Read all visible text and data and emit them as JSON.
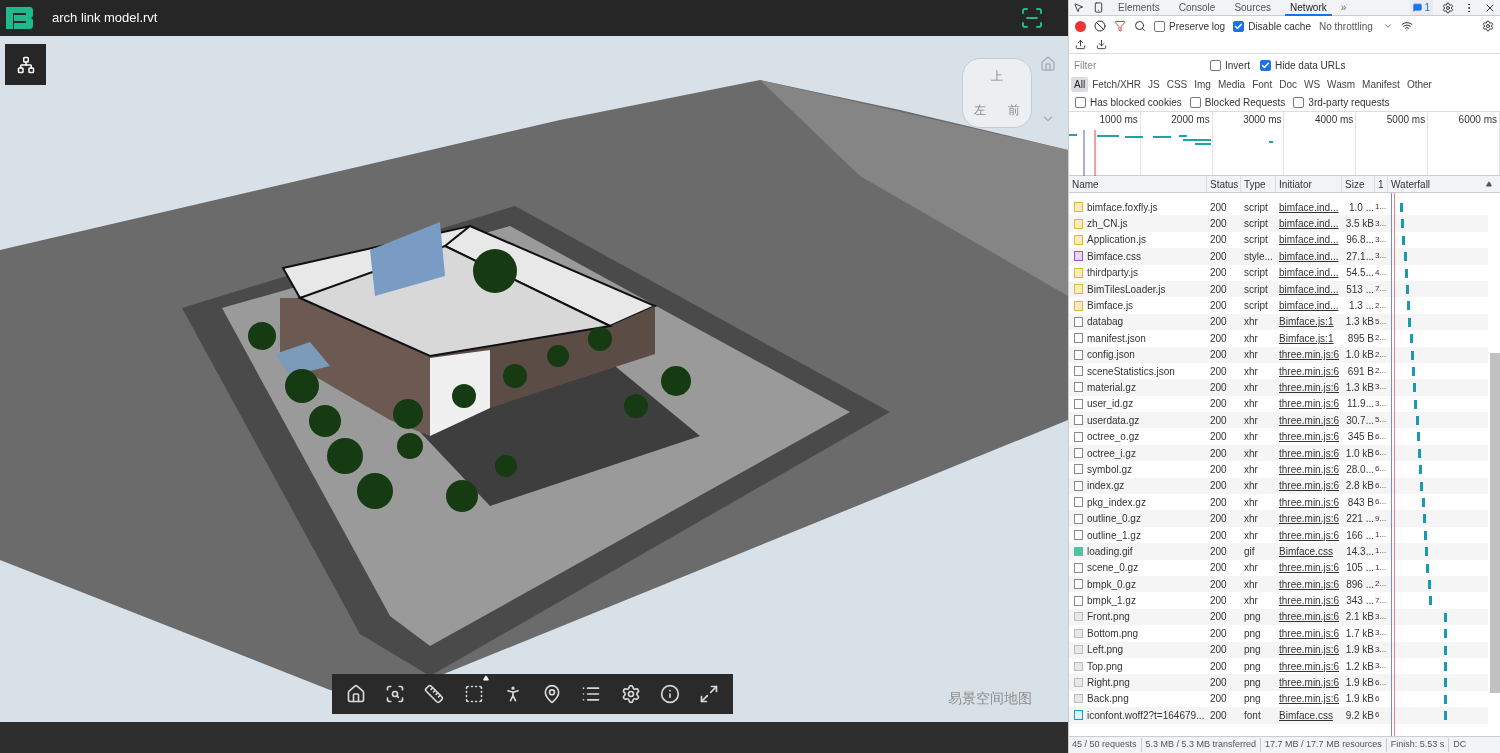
{
  "viewer": {
    "title": "arch link model.rvt",
    "view_cube": [
      "上",
      "左",
      "前"
    ],
    "attribution": "易景空间地图"
  },
  "devtools": {
    "tabs": [
      {
        "label": "Elements",
        "selected": false
      },
      {
        "label": "Console",
        "selected": false
      },
      {
        "label": "Sources",
        "selected": false
      },
      {
        "label": "Network",
        "selected": true
      }
    ],
    "more_tabs": "»",
    "message_count": "1",
    "toolbar": {
      "recording": true,
      "preserve_log": {
        "label": "Preserve log",
        "checked": false
      },
      "disable_cache": {
        "label": "Disable cache",
        "checked": true
      },
      "throttling": "No throttling"
    },
    "filter": {
      "placeholder": "Filter",
      "invert": {
        "label": "Invert",
        "checked": false
      },
      "hide_data_urls": {
        "label": "Hide data URLs",
        "checked": true
      }
    },
    "type_filters": [
      {
        "label": "All",
        "selected": true
      },
      {
        "label": "Fetch/XHR",
        "selected": false
      },
      {
        "label": "JS",
        "selected": false
      },
      {
        "label": "CSS",
        "selected": false
      },
      {
        "label": "Img",
        "selected": false
      },
      {
        "label": "Media",
        "selected": false
      },
      {
        "label": "Font",
        "selected": false
      },
      {
        "label": "Doc",
        "selected": false
      },
      {
        "label": "WS",
        "selected": false
      },
      {
        "label": "Wasm",
        "selected": false
      },
      {
        "label": "Manifest",
        "selected": false
      },
      {
        "label": "Other",
        "selected": false
      }
    ],
    "blocked_filters": [
      {
        "label": "Has blocked cookies",
        "checked": false
      },
      {
        "label": "Blocked Requests",
        "checked": false
      },
      {
        "label": "3rd-party requests",
        "checked": false
      }
    ],
    "overview_ticks": [
      "1000 ms",
      "2000 ms",
      "3000 ms",
      "4000 ms",
      "5000 ms",
      "6000 ms"
    ],
    "table": {
      "columns": [
        "Name",
        "Status",
        "Type",
        "Initiator",
        "Size",
        "1",
        "Waterfall"
      ],
      "rows": [
        {
          "kind": "script",
          "name": "bimface.foxfly.js",
          "status": "200",
          "type": "script",
          "initiator": "bimface.ind...",
          "size": "1.0 ...",
          "column_6": "1..."
        },
        {
          "kind": "script",
          "name": "zh_CN.js",
          "status": "200",
          "type": "script",
          "initiator": "bimface.ind...",
          "size": "3.5 kB",
          "column_6": "3..."
        },
        {
          "kind": "script",
          "name": "Application.js",
          "status": "200",
          "type": "script",
          "initiator": "bimface.ind...",
          "size": "96.8...",
          "column_6": "3..."
        },
        {
          "kind": "stylesheet",
          "name": "Bimface.css",
          "status": "200",
          "type": "style...",
          "initiator": "bimface.ind...",
          "size": "27.1...",
          "column_6": "3..."
        },
        {
          "kind": "script",
          "name": "thirdparty.js",
          "status": "200",
          "type": "script",
          "initiator": "bimface.ind...",
          "size": "54.5...",
          "column_6": "4..."
        },
        {
          "kind": "script",
          "name": "BimTilesLoader.js",
          "status": "200",
          "type": "script",
          "initiator": "bimface.ind...",
          "size": "513 ...",
          "column_6": "7..."
        },
        {
          "kind": "script",
          "name": "Bimface.js",
          "status": "200",
          "type": "script",
          "initiator": "bimface.ind...",
          "size": "1.3 ...",
          "column_6": "2..."
        },
        {
          "kind": "xhr",
          "name": "databag",
          "status": "200",
          "type": "xhr",
          "initiator": "Bimface.js:1",
          "size": "1.3 kB",
          "column_6": "5..."
        },
        {
          "kind": "xhr",
          "name": "manifest.json",
          "status": "200",
          "type": "xhr",
          "initiator": "Bimface.js:1",
          "size": "895 B",
          "column_6": "2..."
        },
        {
          "kind": "xhr",
          "name": "config.json",
          "status": "200",
          "type": "xhr",
          "initiator": "three.min.js:6",
          "size": "1.0 kB",
          "column_6": "2..."
        },
        {
          "kind": "xhr",
          "name": "sceneStatistics.json",
          "status": "200",
          "type": "xhr",
          "initiator": "three.min.js:6",
          "size": "691 B",
          "column_6": "2..."
        },
        {
          "kind": "xhr",
          "name": "material.gz",
          "status": "200",
          "type": "xhr",
          "initiator": "three.min.js:6",
          "size": "1.3 kB",
          "column_6": "3..."
        },
        {
          "kind": "xhr",
          "name": "user_id.gz",
          "status": "200",
          "type": "xhr",
          "initiator": "three.min.js:6",
          "size": "11.9...",
          "column_6": "3..."
        },
        {
          "kind": "xhr",
          "name": "userdata.gz",
          "status": "200",
          "type": "xhr",
          "initiator": "three.min.js:6",
          "size": "30.7...",
          "column_6": "5..."
        },
        {
          "kind": "xhr",
          "name": "octree_o.gz",
          "status": "200",
          "type": "xhr",
          "initiator": "three.min.js:6",
          "size": "345 B",
          "column_6": "6..."
        },
        {
          "kind": "xhr",
          "name": "octree_i.gz",
          "status": "200",
          "type": "xhr",
          "initiator": "three.min.js:6",
          "size": "1.0 kB",
          "column_6": "6..."
        },
        {
          "kind": "xhr",
          "name": "symbol.gz",
          "status": "200",
          "type": "xhr",
          "initiator": "three.min.js:6",
          "size": "28.0...",
          "column_6": "6..."
        },
        {
          "kind": "xhr",
          "name": "index.gz",
          "status": "200",
          "type": "xhr",
          "initiator": "three.min.js:6",
          "size": "2.8 kB",
          "column_6": "6..."
        },
        {
          "kind": "xhr",
          "name": "pkg_index.gz",
          "status": "200",
          "type": "xhr",
          "initiator": "three.min.js:6",
          "size": "843 B",
          "column_6": "6..."
        },
        {
          "kind": "xhr",
          "name": "outline_0.gz",
          "status": "200",
          "type": "xhr",
          "initiator": "three.min.js:6",
          "size": "221 ...",
          "column_6": "9..."
        },
        {
          "kind": "xhr",
          "name": "outline_1.gz",
          "status": "200",
          "type": "xhr",
          "initiator": "three.min.js:6",
          "size": "166 ...",
          "column_6": "1..."
        },
        {
          "kind": "gif",
          "name": "loading.gif",
          "status": "200",
          "type": "gif",
          "initiator": "Bimface.css",
          "size": "14.3...",
          "column_6": "1..."
        },
        {
          "kind": "xhr",
          "name": "scene_0.gz",
          "status": "200",
          "type": "xhr",
          "initiator": "three.min.js:6",
          "size": "105 ...",
          "column_6": "1..."
        },
        {
          "kind": "xhr",
          "name": "bmpk_0.gz",
          "status": "200",
          "type": "xhr",
          "initiator": "three.min.js:6",
          "size": "896 ...",
          "column_6": "2..."
        },
        {
          "kind": "xhr",
          "name": "bmpk_1.gz",
          "status": "200",
          "type": "xhr",
          "initiator": "three.min.js:6",
          "size": "343 ...",
          "column_6": "7..."
        },
        {
          "kind": "image",
          "name": "Front.png",
          "status": "200",
          "type": "png",
          "initiator": "three.min.js:6",
          "size": "2.1 kB",
          "column_6": "3..."
        },
        {
          "kind": "image",
          "name": "Bottom.png",
          "status": "200",
          "type": "png",
          "initiator": "three.min.js:6",
          "size": "1.7 kB",
          "column_6": "3..."
        },
        {
          "kind": "image",
          "name": "Left.png",
          "status": "200",
          "type": "png",
          "initiator": "three.min.js:6",
          "size": "1.9 kB",
          "column_6": "3..."
        },
        {
          "kind": "image",
          "name": "Top.png",
          "status": "200",
          "type": "png",
          "initiator": "three.min.js:6",
          "size": "1.2 kB",
          "column_6": "3..."
        },
        {
          "kind": "image",
          "name": "Right.png",
          "status": "200",
          "type": "png",
          "initiator": "three.min.js:6",
          "size": "1.9 kB",
          "column_6": "6..."
        },
        {
          "kind": "image",
          "name": "Back.png",
          "status": "200",
          "type": "png",
          "initiator": "three.min.js:6",
          "size": "1.9 kB",
          "column_6": "6"
        },
        {
          "kind": "font",
          "name": "iconfont.woff2?t=164679...",
          "status": "200",
          "type": "font",
          "initiator": "Bimface.css",
          "size": "9.2 kB",
          "column_6": "6"
        }
      ]
    },
    "status_bar": [
      "45 / 50 requests",
      "5.3 MB / 5.3 MB transferred",
      "17.7 MB / 17.7 MB resources",
      "Finish: 5.53 s",
      "DC"
    ]
  }
}
